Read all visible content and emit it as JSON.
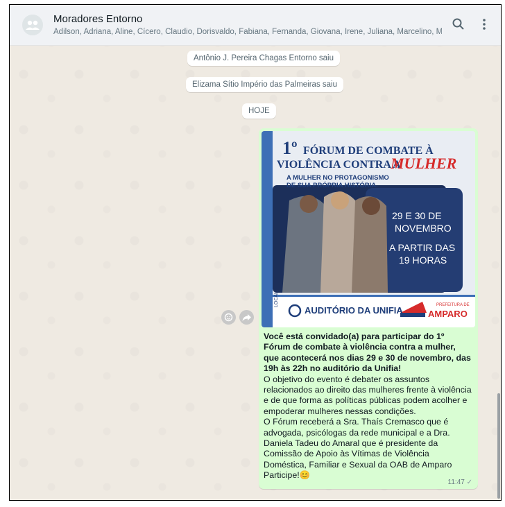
{
  "header": {
    "group_name": "Moradores Entorno",
    "members": "Adilson, Adriana, Aline, Cícero, Claudio, Dorisvaldo, Fabiana, Fernanda, Giovana, Irene, Juliana, Marcelino, Mate..."
  },
  "system_messages": [
    {
      "text": "Antônio J. Pereira Chagas Entorno saiu"
    },
    {
      "text": "Elizama Sítio Império das Palmeiras saiu"
    },
    {
      "text": "HOJE"
    }
  ],
  "poster": {
    "number": "1º",
    "line1": "FÓRUM DE COMBATE À",
    "line2": "VIOLÊNCIA CONTRA A",
    "highlight": "MULHER",
    "sub1": "A MULHER NO PROTAGONISMO",
    "sub2": "DE SUA PRÓPRIA HISTÓRIA.",
    "date1": "29 E 30 DE",
    "date2": "NOVEMBRO",
    "time1": "A PARTIR DAS",
    "time2": "19 HORAS",
    "local_label": "LOCAL:",
    "venue": "AUDITÓRIO DA UNIFIA",
    "logo_top": "PREFEITURA DE",
    "logo_name": "AMPARO"
  },
  "message": {
    "bold": "Você está convidado(a) para participar do 1º Fórum de combate à violência contra a mulher, que acontecerá nos dias 29 e 30 de novembro, das 19h às 22h no auditório da Unifia!",
    "p1": "O objetivo do evento é debater os assuntos relacionados ao direito das mulheres frente à violência e de que forma as políticas públicas podem acolher e empoderar mulheres nessas condições.",
    "p2": "O Fórum receberá a Sra. Thaís Cremasco que é advogada, psicólogas da rede municipal e a Dra. Daniela Tadeu do Amaral que é presidente da Comissão de Apoio às Vítimas de Violência Doméstica, Familiar e Sexual da OAB de Amparo",
    "p3": "Participe!",
    "emoji": "😊",
    "time": "11:47",
    "tick": "✓"
  },
  "colors": {
    "chat_bg": "#efeae2",
    "bubble_out": "#d9fdd3",
    "poster_navy": "#1f3e7a",
    "poster_red": "#d62b2b"
  },
  "icons": [
    "group-avatar-icon",
    "search-icon",
    "menu-icon",
    "emoji-reaction-icon",
    "forward-icon"
  ]
}
